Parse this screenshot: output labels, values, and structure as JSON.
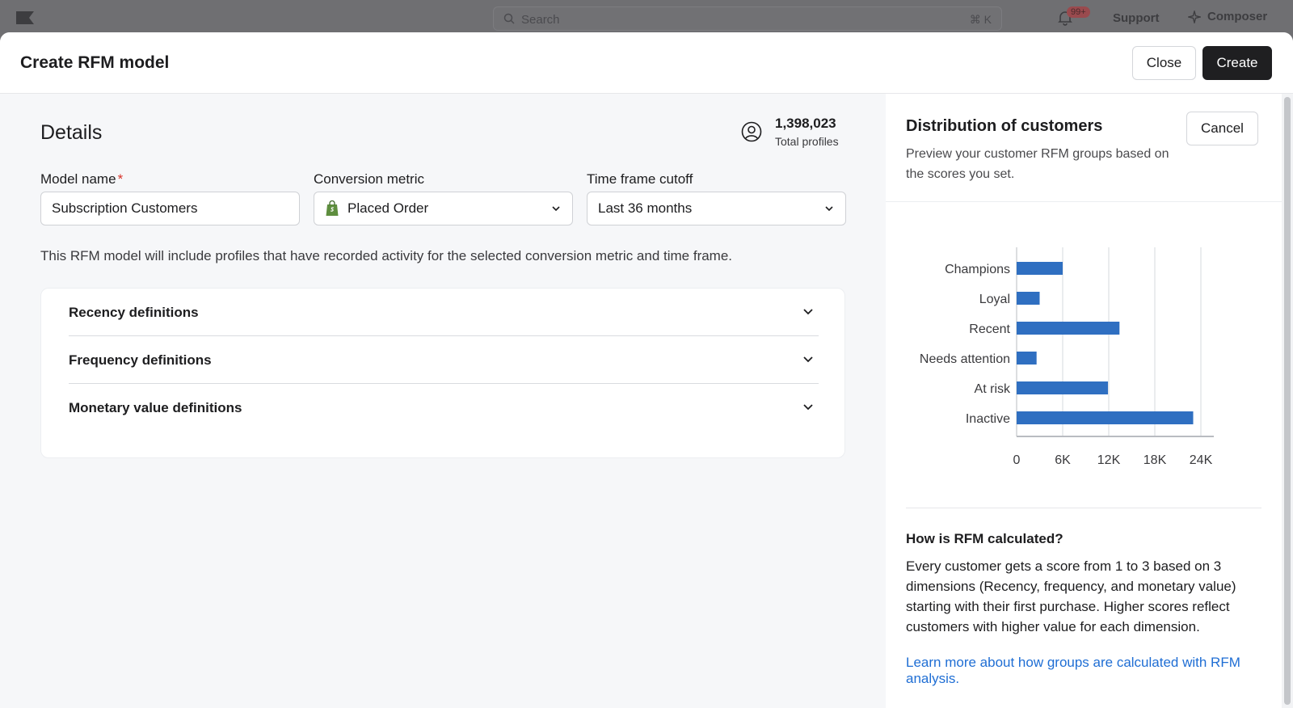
{
  "topbar": {
    "search_placeholder": "Search",
    "search_shortcut": "⌘ K",
    "notifications_badge": "99+",
    "support_label": "Support",
    "composer_label": "Composer"
  },
  "modal": {
    "title": "Create RFM model",
    "close_label": "Close",
    "create_label": "Create"
  },
  "details": {
    "title": "Details",
    "profiles_count": "1,398,023",
    "profiles_label": "Total profiles",
    "model_name_label": "Model name",
    "model_name_required": "*",
    "model_name_value": "Subscription Customers",
    "conversion_metric_label": "Conversion metric",
    "conversion_metric_value": "Placed Order",
    "timeframe_label": "Time frame cutoff",
    "timeframe_value": "Last 36 months",
    "helper_text": "This RFM model will include profiles that have recorded activity for the selected conversion metric and time frame.",
    "accordion": [
      {
        "label": "Recency definitions"
      },
      {
        "label": "Frequency definitions"
      },
      {
        "label": "Monetary value definitions"
      }
    ]
  },
  "distribution": {
    "title": "Distribution of customers",
    "description": "Preview your customer RFM groups based on the scores you set.",
    "cancel_label": "Cancel",
    "how_title": "How is RFM calculated?",
    "how_body": "Every customer gets a score from 1 to 3 based on 3 dimensions (Recency, frequency, and monetary value) starting with their first purchase. Higher scores reflect customers with higher value for each dimension.",
    "learn_more": "Learn more about how groups are calculated with RFM analysis."
  },
  "chart_data": {
    "type": "bar",
    "orientation": "horizontal",
    "categories": [
      "Champions",
      "Loyal",
      "Recent",
      "Needs attention",
      "At risk",
      "Inactive"
    ],
    "values": [
      6000,
      3000,
      13400,
      2600,
      11900,
      23000
    ],
    "xticks": [
      "0",
      "6K",
      "12K",
      "18K",
      "24K"
    ],
    "xlim": [
      0,
      24000
    ],
    "bar_color": "#2f6fc1",
    "grid": true
  },
  "colors": {
    "accent": "#1f6ed4",
    "primary_button": "#1f1f21",
    "required": "#d8332a",
    "bar": "#2f6fc1"
  }
}
